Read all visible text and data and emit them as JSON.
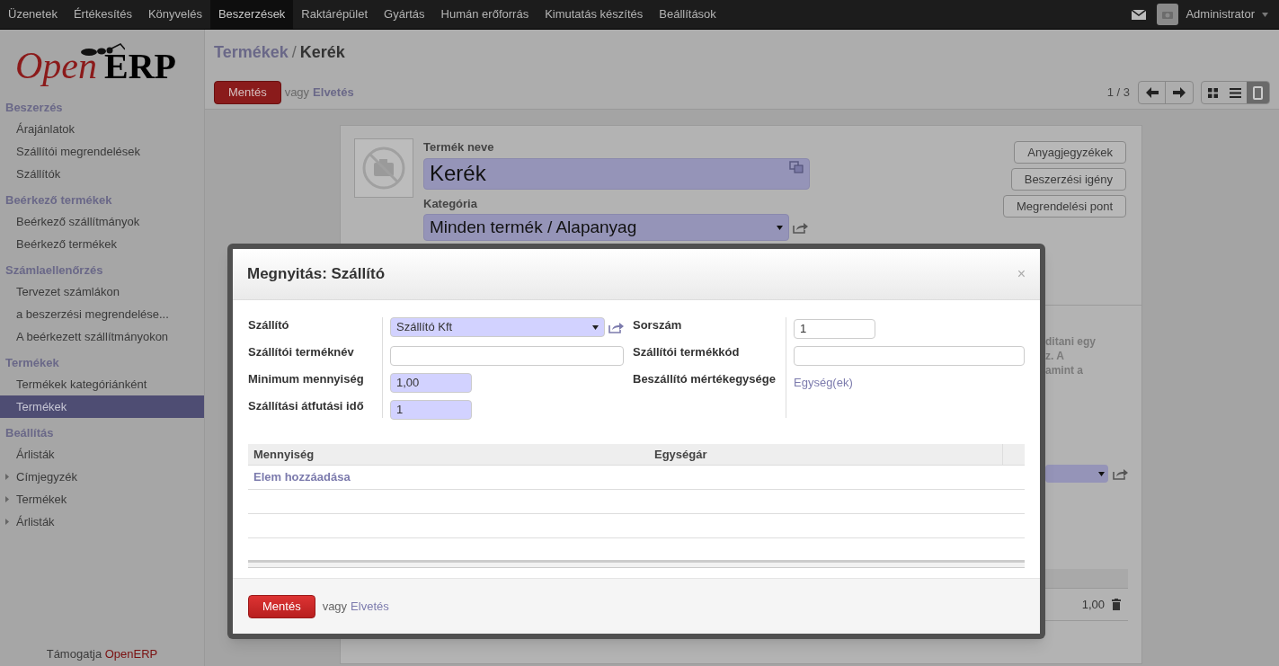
{
  "top_menu": [
    {
      "label": "Üzenetek",
      "selected": false
    },
    {
      "label": "Értékesítés",
      "selected": false
    },
    {
      "label": "Könyvelés",
      "selected": false
    },
    {
      "label": "Beszerzések",
      "selected": true
    },
    {
      "label": "Raktárépület",
      "selected": false
    },
    {
      "label": "Gyártás",
      "selected": false
    },
    {
      "label": "Humán erőforrás",
      "selected": false
    },
    {
      "label": "Kimutatás készítés",
      "selected": false
    },
    {
      "label": "Beállítások",
      "selected": false
    }
  ],
  "user": {
    "name": "Administrator"
  },
  "sidebar": {
    "logo": {
      "first": "Open",
      "second": "ERP"
    },
    "sections": [
      {
        "title": "Beszerzés",
        "items": [
          {
            "label": "Árajánlatok",
            "selected": false,
            "expandable": false
          },
          {
            "label": "Szállítói megrendelések",
            "selected": false,
            "expandable": false
          },
          {
            "label": "Szállítók",
            "selected": false,
            "expandable": false
          }
        ]
      },
      {
        "title": "Beérkező termékek",
        "items": [
          {
            "label": "Beérkező szállítmányok",
            "selected": false,
            "expandable": false
          },
          {
            "label": "Beérkező termékek",
            "selected": false,
            "expandable": false
          }
        ]
      },
      {
        "title": "Számlaellenőrzés",
        "items": [
          {
            "label": "Tervezet számlákon",
            "selected": false,
            "expandable": false
          },
          {
            "label": "a beszerzési megrendelése...",
            "selected": false,
            "expandable": false
          },
          {
            "label": "A beérkezett szállítmányokon",
            "selected": false,
            "expandable": false
          }
        ]
      },
      {
        "title": "Termékek",
        "items": [
          {
            "label": "Termékek kategóriánként",
            "selected": false,
            "expandable": false
          },
          {
            "label": "Termékek",
            "selected": true,
            "expandable": false
          }
        ]
      },
      {
        "title": "Beállítás",
        "items": [
          {
            "label": "Árlisták",
            "selected": false,
            "expandable": false
          },
          {
            "label": "Címjegyzék",
            "selected": false,
            "expandable": true
          },
          {
            "label": "Termékek",
            "selected": false,
            "expandable": true
          },
          {
            "label": "Árlisták",
            "selected": false,
            "expandable": true
          }
        ]
      }
    ],
    "footer": {
      "prefix": "Támogatja",
      "link": "OpenERP"
    }
  },
  "breadcrumb": {
    "parent": "Termékek",
    "separator": "/",
    "current": "Kerék"
  },
  "toolbar": {
    "save": "Mentés",
    "or": "vagy",
    "discard": "Elvetés",
    "pager": "1 / 3",
    "views": [
      {
        "kind": "kanban",
        "selected": false
      },
      {
        "kind": "list",
        "selected": false
      },
      {
        "kind": "form",
        "selected": true
      }
    ]
  },
  "form": {
    "name_label": "Termék neve",
    "name_value": "Kerék",
    "category_label": "Kategória",
    "category_value": "Minden termék / Alapanyag",
    "buttons": [
      "Anyagjegyzékek",
      "Beszerzési igény",
      "Megrendelési pont"
    ],
    "note_fragments": [
      "ditani egy",
      "z. A",
      "amint a"
    ],
    "line_value": "1,00"
  },
  "dialog": {
    "title": "Megnyitás: Szállító",
    "close": "×",
    "left_fields": [
      {
        "label": "Szállító",
        "kind": "select",
        "value": "Szállító Kft",
        "required": true
      },
      {
        "label": "Szállítói terméknév",
        "kind": "text",
        "required": false
      },
      {
        "label": "Minimum mennyiség",
        "kind": "text",
        "value": "1,00",
        "required": true
      },
      {
        "label": "Szállítási átfutási idő",
        "kind": "text",
        "value": "1",
        "required": true
      }
    ],
    "right_fields": [
      {
        "label": "Sorszám",
        "kind": "text",
        "value": "1",
        "required": false
      },
      {
        "label": "Szállítói termékkód",
        "kind": "text",
        "required": false
      },
      {
        "label": "Beszállító mértékegysége",
        "kind": "link",
        "value": "Egység(ek)"
      }
    ],
    "table": {
      "columns": [
        "Mennyiség",
        "Egységár"
      ],
      "add_item": "Elem hozzáadása"
    },
    "footer": {
      "save": "Mentés",
      "or": "vagy",
      "discard": "Elvetés"
    }
  }
}
